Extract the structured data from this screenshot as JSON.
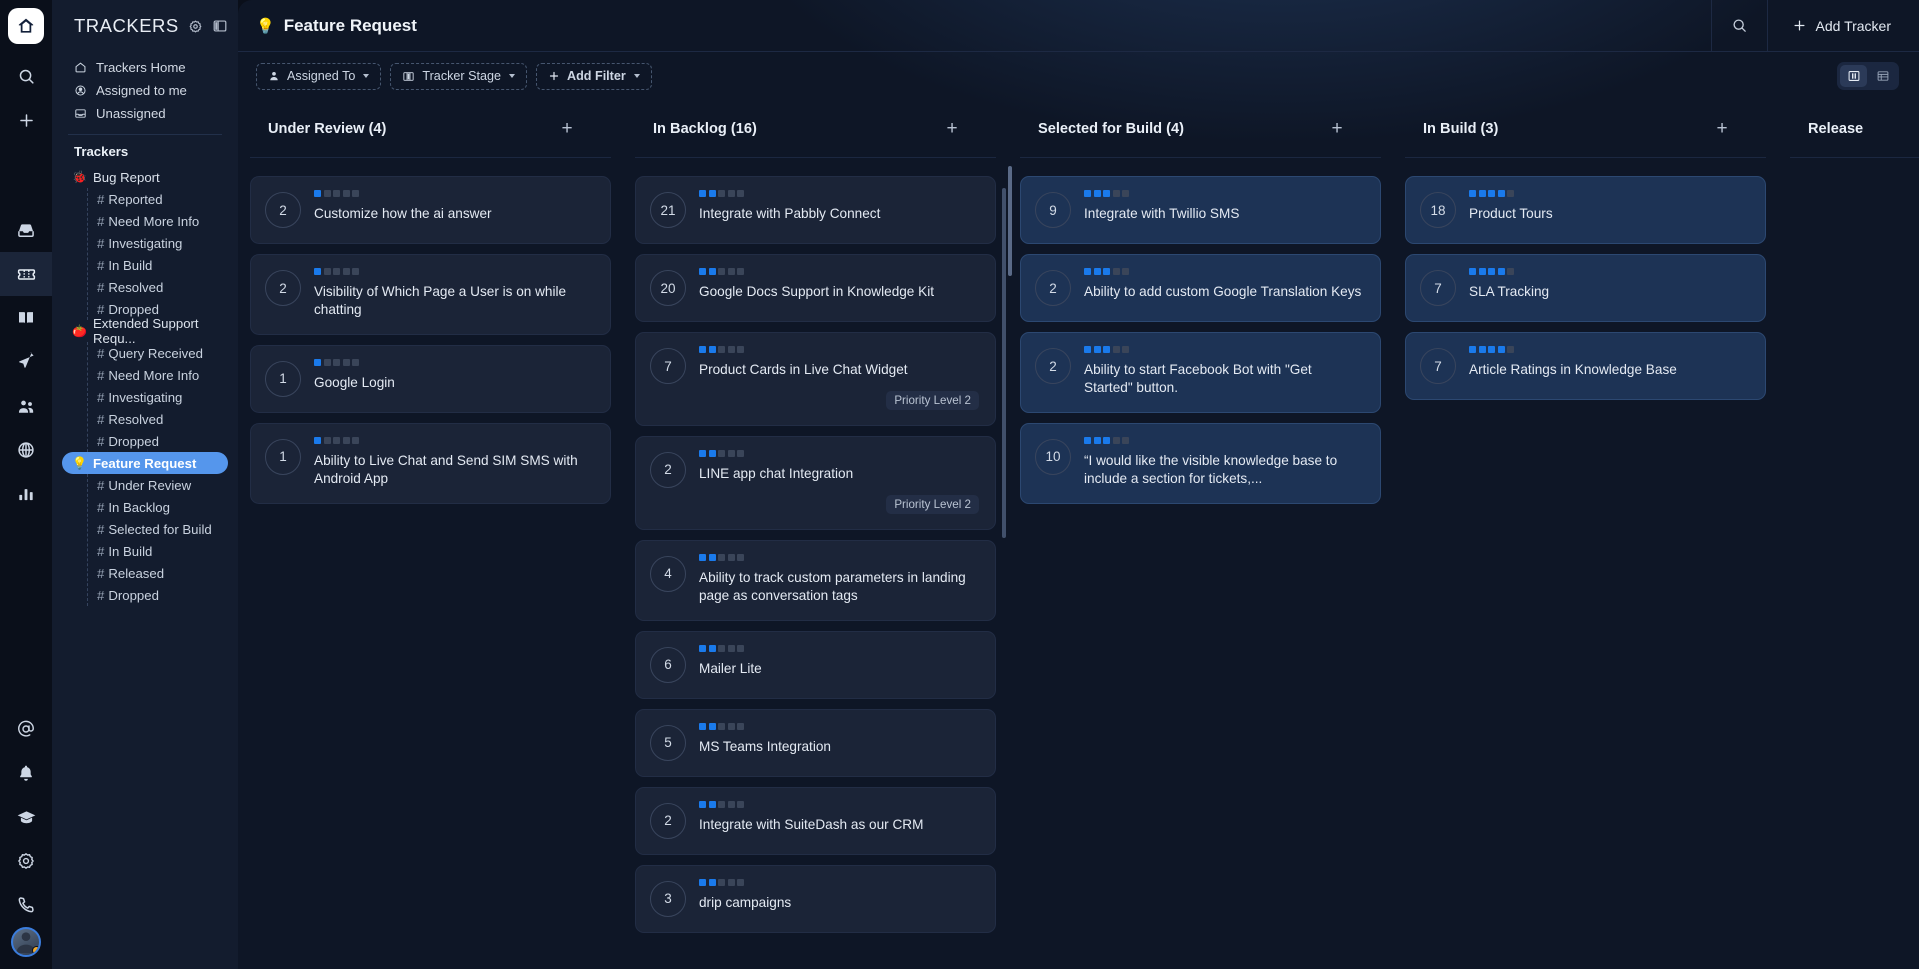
{
  "rail": {
    "logo_icon": "home-icon",
    "top_items": [
      {
        "icon": "search-icon",
        "name": "rail-search"
      },
      {
        "icon": "plus-icon",
        "name": "rail-add"
      }
    ],
    "mid_items": [
      {
        "icon": "inbox-icon",
        "name": "rail-inbox",
        "active": false
      },
      {
        "icon": "ticket-icon",
        "name": "rail-tickets",
        "active": true
      },
      {
        "icon": "book-icon",
        "name": "rail-knowledge-base",
        "active": false
      },
      {
        "icon": "send-icon",
        "name": "rail-campaigns",
        "active": false
      },
      {
        "icon": "people-icon",
        "name": "rail-contacts",
        "active": false
      },
      {
        "icon": "globe-icon",
        "name": "rail-sites",
        "active": false
      },
      {
        "icon": "chart-icon",
        "name": "rail-reports",
        "active": false
      }
    ],
    "bottom_items": [
      {
        "icon": "at-icon",
        "name": "rail-mentions"
      },
      {
        "icon": "bell-icon",
        "name": "rail-notifications"
      },
      {
        "icon": "graduation-cap-icon",
        "name": "rail-learn"
      },
      {
        "icon": "gear-icon",
        "name": "rail-settings"
      },
      {
        "icon": "phone-icon",
        "name": "rail-calls"
      }
    ]
  },
  "sidebar": {
    "title": "TRACKERS",
    "header_icons": [
      "gear-icon",
      "panel-collapse-icon"
    ],
    "nav": [
      {
        "label": "Trackers Home",
        "icon": "home-outline-icon"
      },
      {
        "label": "Assigned to me",
        "icon": "user-circle-icon"
      },
      {
        "label": "Unassigned",
        "icon": "inbox-tray-icon"
      }
    ],
    "section_label": "Trackers",
    "trackers": [
      {
        "name": "Bug Report",
        "emoji": "🐞",
        "selected": false,
        "stages": [
          "Reported",
          "Need More Info",
          "Investigating",
          "In Build",
          "Resolved",
          "Dropped"
        ]
      },
      {
        "name": "Extended Support Requ...",
        "emoji": "🍅",
        "selected": false,
        "stages": [
          "Query Received",
          "Need More Info",
          "Investigating",
          "Resolved",
          "Dropped"
        ]
      },
      {
        "name": "Feature Request",
        "emoji": "💡",
        "selected": true,
        "stages": [
          "Under Review",
          "In Backlog",
          "Selected for Build",
          "In Build",
          "Released",
          "Dropped"
        ]
      }
    ]
  },
  "topbar": {
    "page_emoji": "💡",
    "page_title": "Feature Request",
    "search_icon": "search-icon",
    "add_tracker_label": "Add Tracker",
    "add_tracker_icon": "plus-icon"
  },
  "filterbar": {
    "filters": [
      {
        "label": "Assigned To",
        "icon": "person-icon"
      },
      {
        "label": "Tracker Stage",
        "icon": "columns-icon"
      }
    ],
    "add_filter_label": "Add Filter",
    "views": [
      {
        "name": "kanban-view",
        "icon": "kanban-icon",
        "active": true
      },
      {
        "name": "list-view",
        "icon": "list-icon",
        "active": false
      }
    ]
  },
  "board": {
    "columns": [
      {
        "title": "Under Review (4)",
        "add_icon": "plus-icon",
        "cards": [
          {
            "votes": "2",
            "title": "Customize how the ai answer",
            "priority_filled": 1,
            "priority_total": 5,
            "highlight": false,
            "badge": null
          },
          {
            "votes": "2",
            "title": "Visibility of Which Page a User is on while chatting",
            "priority_filled": 1,
            "priority_total": 5,
            "highlight": false,
            "badge": null
          },
          {
            "votes": "1",
            "title": "Google Login",
            "priority_filled": 1,
            "priority_total": 5,
            "highlight": false,
            "badge": null
          },
          {
            "votes": "1",
            "title": "Ability to Live Chat and Send SIM SMS with Android App",
            "priority_filled": 1,
            "priority_total": 5,
            "highlight": false,
            "badge": null
          }
        ]
      },
      {
        "title": "In Backlog (16)",
        "add_icon": "plus-icon",
        "cards": [
          {
            "votes": "21",
            "title": "Integrate with Pabbly Connect",
            "priority_filled": 2,
            "priority_total": 5,
            "highlight": false,
            "badge": null
          },
          {
            "votes": "20",
            "title": "Google Docs Support in Knowledge Kit",
            "priority_filled": 2,
            "priority_total": 5,
            "highlight": false,
            "badge": null
          },
          {
            "votes": "7",
            "title": "Product Cards in Live Chat Widget",
            "priority_filled": 2,
            "priority_total": 5,
            "highlight": false,
            "badge": "Priority Level 2"
          },
          {
            "votes": "2",
            "title": "LINE app chat Integration",
            "priority_filled": 2,
            "priority_total": 5,
            "highlight": false,
            "badge": "Priority Level 2"
          },
          {
            "votes": "4",
            "title": "Ability to track custom parameters in landing page as conversation tags",
            "priority_filled": 2,
            "priority_total": 5,
            "highlight": false,
            "badge": null
          },
          {
            "votes": "6",
            "title": "Mailer Lite",
            "priority_filled": 2,
            "priority_total": 5,
            "highlight": false,
            "badge": null
          },
          {
            "votes": "5",
            "title": "MS Teams Integration",
            "priority_filled": 2,
            "priority_total": 5,
            "highlight": false,
            "badge": null
          },
          {
            "votes": "2",
            "title": "Integrate with SuiteDash as our CRM",
            "priority_filled": 2,
            "priority_total": 5,
            "highlight": false,
            "badge": null
          },
          {
            "votes": "3",
            "title": "drip campaigns",
            "priority_filled": 2,
            "priority_total": 5,
            "highlight": false,
            "badge": null
          }
        ]
      },
      {
        "title": "Selected for Build (4)",
        "add_icon": "plus-icon",
        "cards": [
          {
            "votes": "9",
            "title": "Integrate with Twillio SMS",
            "priority_filled": 3,
            "priority_total": 5,
            "highlight": true,
            "badge": null
          },
          {
            "votes": "2",
            "title": "Ability to add custom Google Translation Keys",
            "priority_filled": 3,
            "priority_total": 5,
            "highlight": true,
            "badge": null
          },
          {
            "votes": "2",
            "title": "Ability to start Facebook Bot with \"Get Started\" button.",
            "priority_filled": 3,
            "priority_total": 5,
            "highlight": true,
            "badge": null
          },
          {
            "votes": "10",
            "title": "“I would like the visible knowledge base to include a section for tickets,...",
            "priority_filled": 3,
            "priority_total": 5,
            "highlight": true,
            "badge": null
          }
        ]
      },
      {
        "title": "In Build (3)",
        "add_icon": "plus-icon",
        "cards": [
          {
            "votes": "18",
            "title": "Product Tours",
            "priority_filled": 4,
            "priority_total": 5,
            "highlight": true,
            "badge": null
          },
          {
            "votes": "7",
            "title": "SLA Tracking",
            "priority_filled": 4,
            "priority_total": 5,
            "highlight": true,
            "badge": null
          },
          {
            "votes": "7",
            "title": "Article Ratings in Knowledge Base",
            "priority_filled": 4,
            "priority_total": 5,
            "highlight": true,
            "badge": null
          }
        ]
      },
      {
        "title": "Release",
        "add_icon": "plus-icon",
        "cards": []
      }
    ]
  }
}
